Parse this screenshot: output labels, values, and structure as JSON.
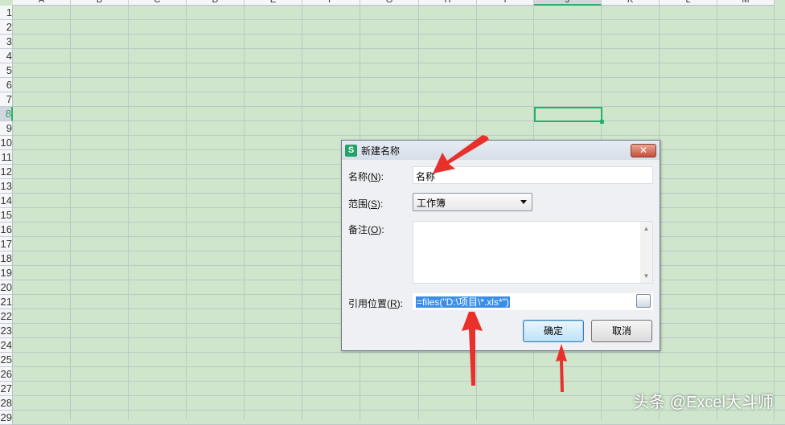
{
  "spreadsheet": {
    "columns": [
      "A",
      "B",
      "C",
      "D",
      "E",
      "F",
      "G",
      "H",
      "I",
      "J",
      "K",
      "L",
      "M"
    ],
    "rows": [
      "1",
      "2",
      "3",
      "4",
      "5",
      "6",
      "7",
      "8",
      "9",
      "10",
      "11",
      "12",
      "13",
      "14",
      "15",
      "16",
      "17",
      "18",
      "19",
      "20",
      "21",
      "22",
      "23",
      "24",
      "25",
      "26",
      "27",
      "28",
      "29"
    ],
    "selected_cell": "J8"
  },
  "dialog": {
    "title": "新建名称",
    "logo": "S",
    "close": "✕",
    "name_label": "名称(",
    "name_key": "N",
    "name_suffix": "):",
    "name_value": "名称",
    "scope_label": "范围(",
    "scope_key": "S",
    "scope_suffix": "):",
    "scope_value": "工作簿",
    "note_label": "备注(",
    "note_key": "O",
    "note_suffix": "):",
    "ref_label": "引用位置(",
    "ref_key": "R",
    "ref_suffix": "):",
    "ref_value": "=files(\"D:\\项目\\*.xls*\")",
    "ok": "确定",
    "cancel": "取消"
  },
  "watermark": "头条 @Excel大斗师",
  "colors": {
    "grid_bg": "#cfe6cc",
    "accent": "#27b06b",
    "arrow": "#e8312a"
  }
}
